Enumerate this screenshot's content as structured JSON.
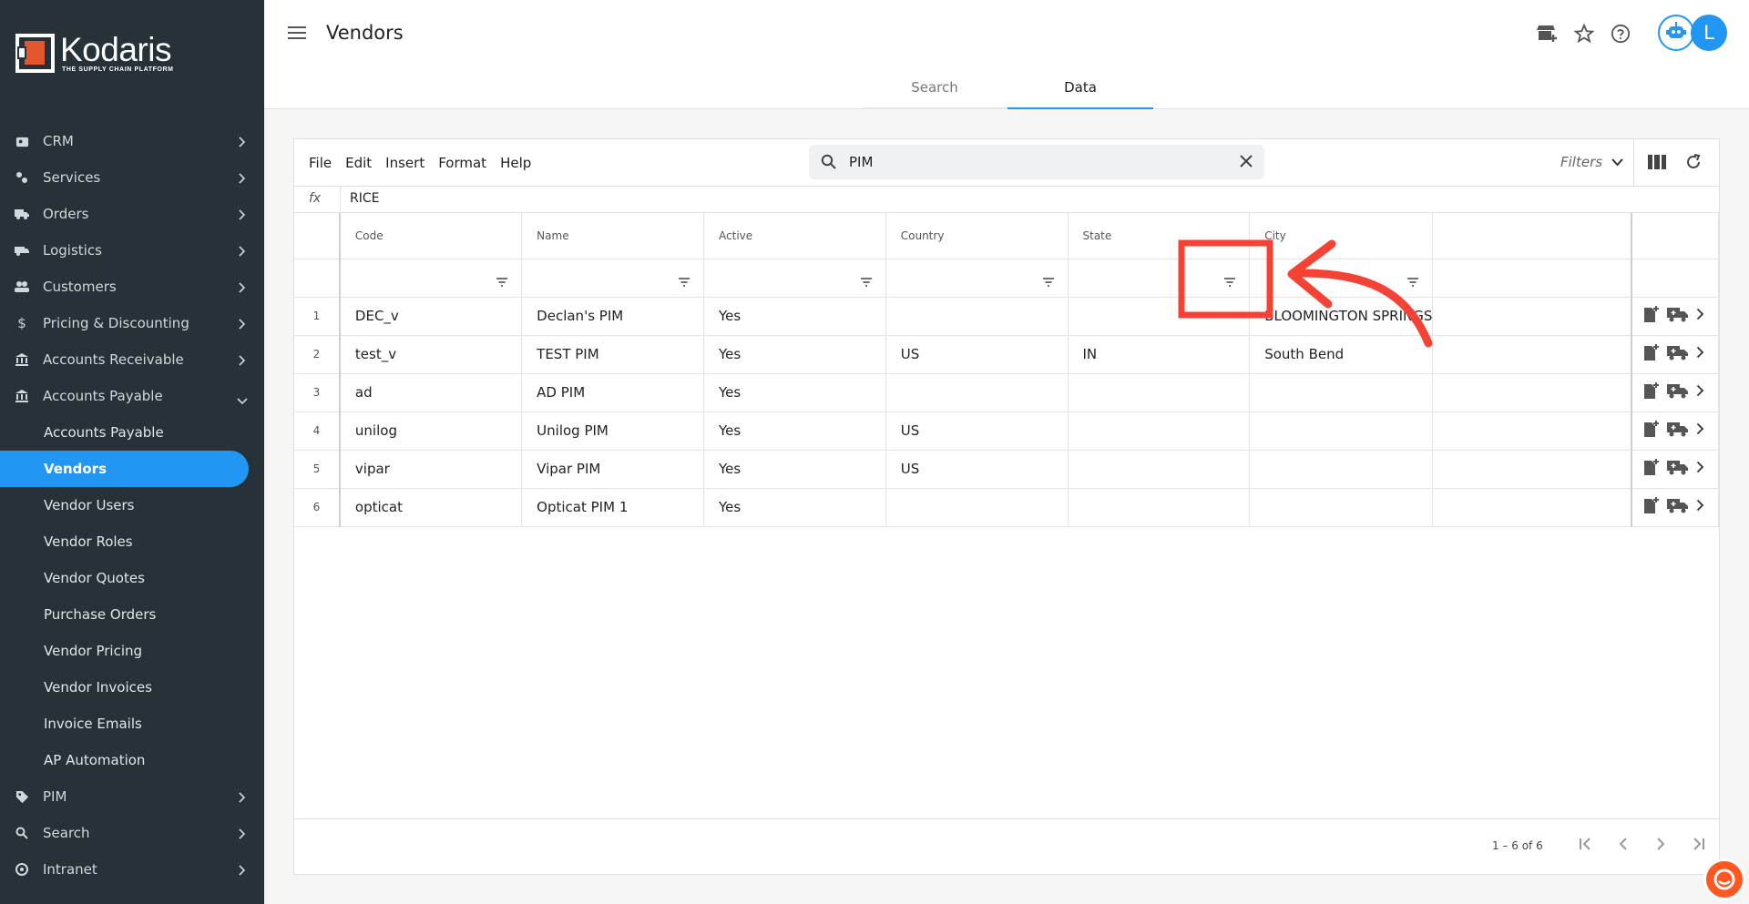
{
  "app": {
    "logo_name": "Kodaris",
    "logo_tagline": "THE SUPPLY CHAIN PLATFORM",
    "accent_color": "#2196f3",
    "sidebar_bg": "#263238"
  },
  "sidebar": {
    "items": [
      {
        "label": "CRM",
        "icon": "crm-icon"
      },
      {
        "label": "Services",
        "icon": "services-icon"
      },
      {
        "label": "Orders",
        "icon": "truck-icon"
      },
      {
        "label": "Logistics",
        "icon": "logistics-icon"
      },
      {
        "label": "Customers",
        "icon": "people-icon"
      },
      {
        "label": "Pricing & Discounting",
        "icon": "dollar-icon"
      },
      {
        "label": "Accounts Receivable",
        "icon": "bank-icon"
      },
      {
        "label": "Accounts Payable",
        "icon": "bank-icon"
      }
    ],
    "subitems": [
      "Accounts Payable",
      "Vendors",
      "Vendor Users",
      "Vendor Roles",
      "Vendor Quotes",
      "Purchase Orders",
      "Vendor Pricing",
      "Vendor Invoices",
      "Invoice Emails",
      "AP Automation"
    ],
    "bottom_items": [
      {
        "label": "PIM",
        "icon": "tag-icon"
      },
      {
        "label": "Search",
        "icon": "search-icon"
      },
      {
        "label": "Intranet",
        "icon": "intranet-icon"
      }
    ],
    "active_subitem": "Vendors"
  },
  "header": {
    "title": "Vendors",
    "avatar_letter": "L",
    "tabs": [
      {
        "label": "Search",
        "active": false
      },
      {
        "label": "Data",
        "active": true
      }
    ]
  },
  "toolbar": {
    "menu": [
      "File",
      "Edit",
      "Insert",
      "Format",
      "Help"
    ],
    "search_value": "PIM",
    "filters_label": "Filters"
  },
  "formula_bar": {
    "label": "fx",
    "value": "RICE"
  },
  "grid": {
    "columns": [
      "Code",
      "Name",
      "Active",
      "Country",
      "State",
      "City",
      ""
    ],
    "rows": [
      {
        "index": "1",
        "code": "DEC_v",
        "name": "Declan's PIM",
        "active": "Yes",
        "country": "",
        "state": "",
        "city": "BLOOMINGTON SPRINGS"
      },
      {
        "index": "2",
        "code": "test_v",
        "name": "TEST PIM",
        "active": "Yes",
        "country": "US",
        "state": "IN",
        "city": "South Bend"
      },
      {
        "index": "3",
        "code": "ad",
        "name": "AD PIM",
        "active": "Yes",
        "country": "",
        "state": "",
        "city": ""
      },
      {
        "index": "4",
        "code": "unilog",
        "name": "Unilog PIM",
        "active": "Yes",
        "country": "US",
        "state": "",
        "city": ""
      },
      {
        "index": "5",
        "code": "vipar",
        "name": "Vipar PIM",
        "active": "Yes",
        "country": "US",
        "state": "",
        "city": ""
      },
      {
        "index": "6",
        "code": "opticat",
        "name": "Opticat PIM 1",
        "active": "Yes",
        "country": "",
        "state": "",
        "city": ""
      }
    ]
  },
  "pagination": {
    "info": "1 – 6 of 6"
  },
  "annotation": {
    "color": "#f44336"
  }
}
